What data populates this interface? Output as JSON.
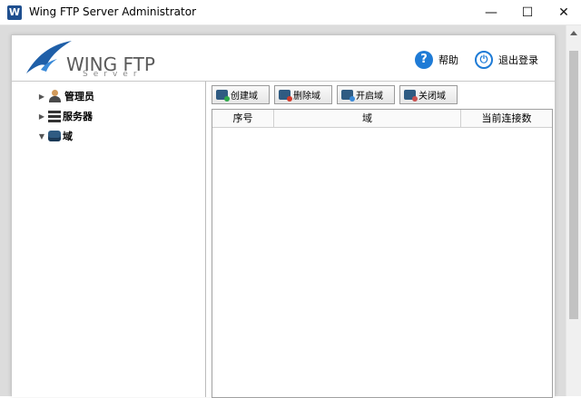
{
  "window": {
    "title": "Wing FTP Server Administrator",
    "controls": {
      "minimize": "—",
      "maximize": "☐",
      "close": "✕"
    }
  },
  "logo": {
    "main": "WING FTP",
    "sub": "Server"
  },
  "header": {
    "help_label": "帮助",
    "logout_label": "退出登录"
  },
  "tree": {
    "items": [
      {
        "label": "管理员",
        "icon": "user-icon",
        "expanded": false
      },
      {
        "label": "服务器",
        "icon": "server-icon",
        "expanded": false
      },
      {
        "label": "域",
        "icon": "domain-icon",
        "expanded": true
      }
    ]
  },
  "toolbar": {
    "create": "创建域",
    "delete": "删除域",
    "start": "开启域",
    "stop": "关闭域"
  },
  "table": {
    "columns": [
      "序号",
      "域",
      "当前连接数"
    ],
    "rows": []
  },
  "colors": {
    "accent": "#1e7bd6",
    "domain_icon": "#2f5b82"
  }
}
